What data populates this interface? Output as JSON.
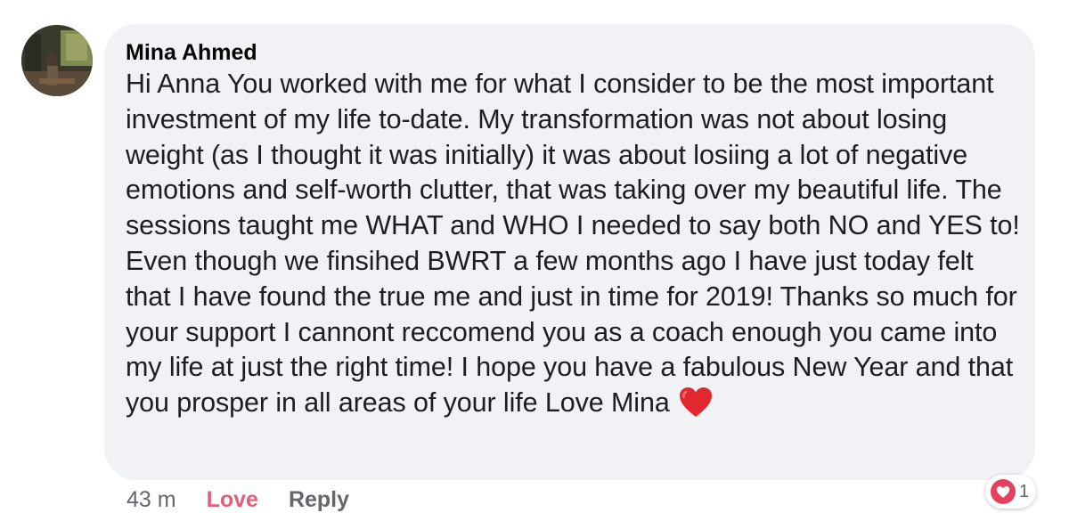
{
  "comment": {
    "author": "Mina Ahmed",
    "text": "Hi Anna  You worked with me for what I consider to be the most important investment of my life to-date. My transformation was not about losing weight (as I thought it was initially) it was about losiing a lot  of negative emotions and self-worth clutter, that was taking over my beautiful life. The sessions taught me WHAT and WHO I needed to say both NO and YES to! Even though we finsihed BWRT a few months ago I have just today felt that I have found the true me and just in time for 2019! Thanks so much for your support I cannont reccomend you as a coach enough you came into my life at just the right time! I hope you have a fabulous New Year and that you prosper in all areas of your life Love Mina",
    "emoji_icon": "red-heart-icon",
    "timestamp": "43 m",
    "actions": {
      "love_label": "Love",
      "reply_label": "Reply"
    },
    "reactions": {
      "icon": "heart-icon",
      "count": "1"
    }
  },
  "colors": {
    "bubble": "#f0f2f5",
    "love_accent": "#e0607a",
    "reaction_heart": "#e5405e",
    "muted_text": "#65676b"
  }
}
